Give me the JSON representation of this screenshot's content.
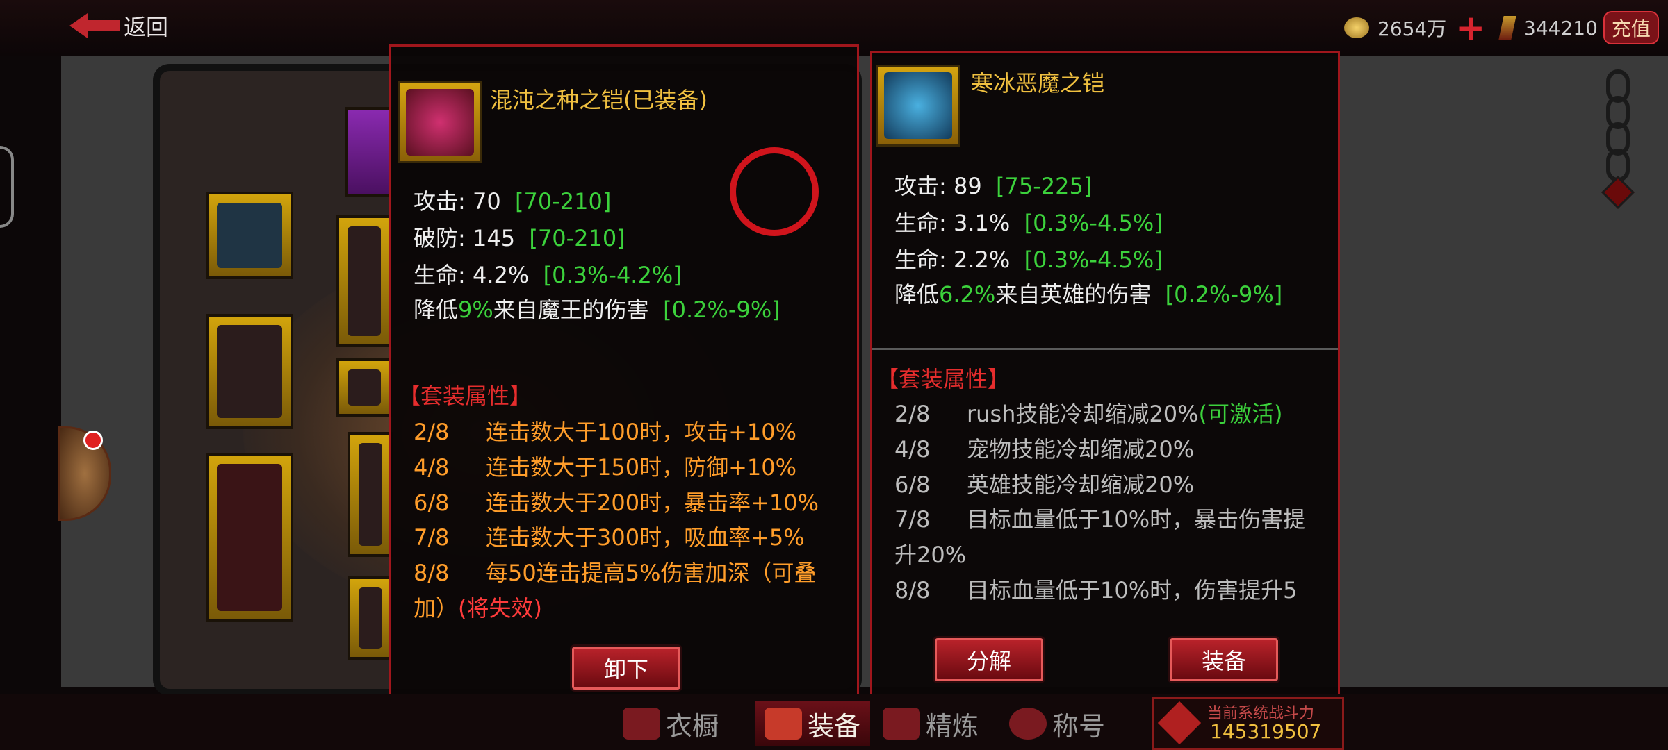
{
  "header": {
    "back_label": "返回",
    "gold_amount": "2654万",
    "gem_amount": "344210",
    "recharge_label": "充值"
  },
  "panel_equipped": {
    "name": "混沌之种之铠",
    "status": "(已装备)",
    "stats": [
      {
        "label": "攻击:",
        "value": "70",
        "range": "[70-210]"
      },
      {
        "label": "破防:",
        "value": "145",
        "range": "[70-210]"
      },
      {
        "label": "生命:",
        "value": "4.2%",
        "range": "[0.3%-4.2%]"
      }
    ],
    "special": {
      "prefix": "降低",
      "value": "9%",
      "suffix": "来自魔王的伤害",
      "range": "[0.2%-9%]"
    },
    "set_header": "【套装属性】",
    "set_bonuses": [
      {
        "pieces": "2/8",
        "text": "连击数大于100时，攻击+10%"
      },
      {
        "pieces": "4/8",
        "text": "连击数大于150时，防御+10%"
      },
      {
        "pieces": "6/8",
        "text": "连击数大于200时，暴击率+10%"
      },
      {
        "pieces": "7/8",
        "text": "连击数大于300时，吸血率+5%"
      },
      {
        "pieces": "8/8",
        "text": "每50连击提高5%伤害加深（可叠"
      }
    ],
    "set_last_wrap": "加）",
    "set_last_status": "(将失效)",
    "unequip_label": "卸下"
  },
  "panel_compare": {
    "name": "寒冰恶魔之铠",
    "stats": [
      {
        "label": "攻击:",
        "value": "89",
        "range": "[75-225]"
      },
      {
        "label": "生命:",
        "value": "3.1%",
        "range": "[0.3%-4.5%]"
      },
      {
        "label": "生命:",
        "value": "2.2%",
        "range": "[0.3%-4.5%]"
      }
    ],
    "special": {
      "prefix": "降低",
      "value": "6.2%",
      "suffix": "来自英雄的伤害",
      "range": "[0.2%-9%]"
    },
    "set_header": "【套装属性】",
    "set_bonuses": [
      {
        "pieces": "2/8",
        "text": "rush技能冷却缩减20%",
        "status": "(可激活)"
      },
      {
        "pieces": "4/8",
        "text": "宠物技能冷却缩减20%",
        "status": ""
      },
      {
        "pieces": "6/8",
        "text": "英雄技能冷却缩减20%",
        "status": ""
      },
      {
        "pieces": "7/8",
        "text": "目标血量低于10%时，暴击伤害提",
        "status": ""
      },
      {
        "pieces": "8/8",
        "text": "目标血量低于10%时，伤害提升5",
        "status": ""
      }
    ],
    "set_wrap_7": "升20%",
    "dismantle_label": "分解",
    "equip_label": "装备"
  },
  "tabs": [
    {
      "label": "衣橱",
      "active": false
    },
    {
      "label": "装备",
      "active": true
    },
    {
      "label": "精炼",
      "active": false
    },
    {
      "label": "称号",
      "active": false
    }
  ],
  "power": {
    "label": "当前系统战斗力",
    "value": "145319507"
  }
}
